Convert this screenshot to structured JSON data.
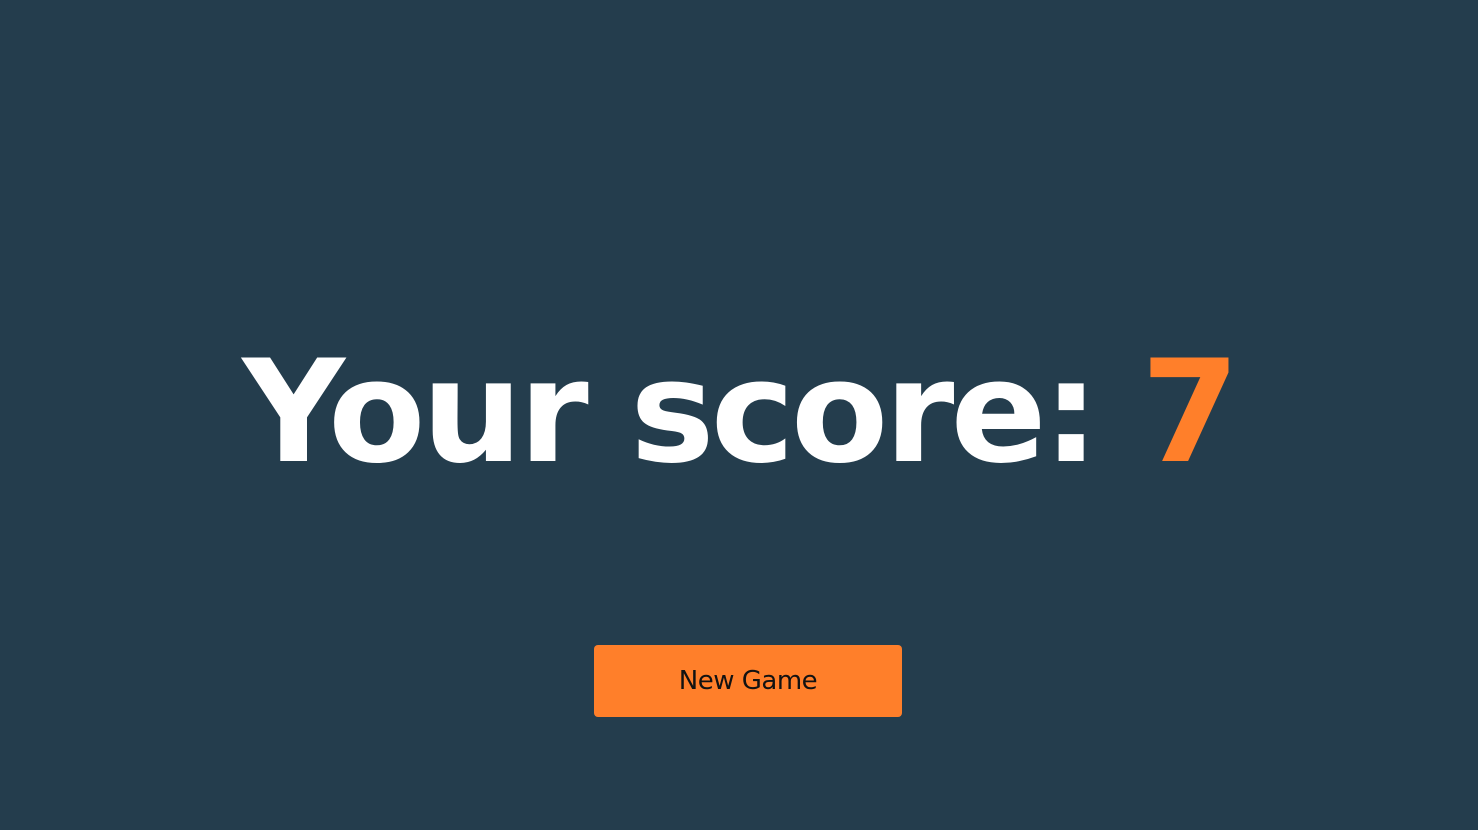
{
  "colors": {
    "background": "#243d4d",
    "heading_text": "#ffffff",
    "accent": "#ff7f2a",
    "button_text": "#121212"
  },
  "result": {
    "score_label": "Your score: ",
    "score_value": "7"
  },
  "actions": {
    "new_game_label": "New Game"
  }
}
